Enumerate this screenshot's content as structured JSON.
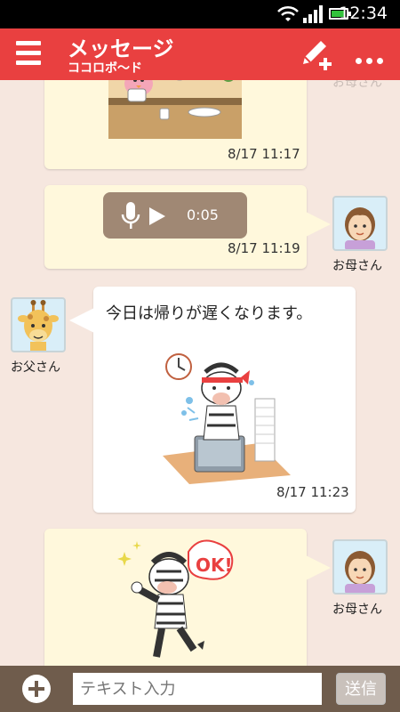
{
  "status_bar": {
    "time": "12:34",
    "battery_level": 0.85
  },
  "app_bar": {
    "title": "メッセージ",
    "subtitle": "ココロボ～ド"
  },
  "messages": [
    {
      "type": "image",
      "sender": "self",
      "time": "8/17 11:17"
    },
    {
      "type": "voice",
      "sender": "お母さん",
      "duration": "0:05",
      "time": "8/17 11:19"
    },
    {
      "type": "text_stamp",
      "sender": "お父さん",
      "text": "今日は帰りが遅くなります。",
      "time": "8/17 11:23"
    },
    {
      "type": "stamp",
      "sender": "お母さん",
      "stamp_text": "OK!"
    }
  ],
  "faded_name": "お母さん",
  "input_bar": {
    "placeholder": "テキスト入力",
    "send_label": "送信"
  },
  "colors": {
    "app_bar": "#e94040",
    "chat_bg": "#f6e7df",
    "bubble_cream": "#fff8dc",
    "input_bar": "#6f5c4c"
  }
}
